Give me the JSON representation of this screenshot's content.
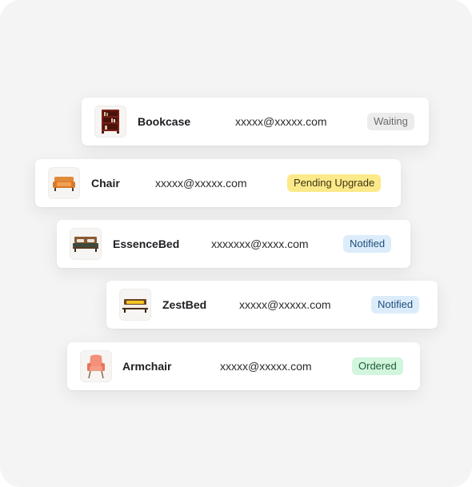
{
  "colors": {
    "panel_bg": "#f4f4f5",
    "card_bg": "#ffffff",
    "waiting_bg": "#ececec",
    "waiting_fg": "#6b6b6b",
    "pending_bg": "#fce98a",
    "pending_fg": "#3d3410",
    "notified_bg": "#dcecfb",
    "notified_fg": "#1f4f7a",
    "ordered_bg": "#d2f5de",
    "ordered_fg": "#1d5c35"
  },
  "rows": [
    {
      "product": "Bookcase",
      "email": "xxxxx@xxxxx.com",
      "status": "Waiting",
      "icon": "bookcase-icon"
    },
    {
      "product": "Chair",
      "email": "xxxxx@xxxxx.com",
      "status": "Pending Upgrade",
      "icon": "sofa-chair-icon"
    },
    {
      "product": "EssenceBed",
      "email": "xxxxxxx@xxxx.com",
      "status": "Notified",
      "icon": "bed-icon"
    },
    {
      "product": "ZestBed",
      "email": "xxxxx@xxxxx.com",
      "status": "Notified",
      "icon": "bed-icon"
    },
    {
      "product": "Armchair",
      "email": "xxxxx@xxxxx.com",
      "status": "Ordered",
      "icon": "armchair-icon"
    }
  ]
}
